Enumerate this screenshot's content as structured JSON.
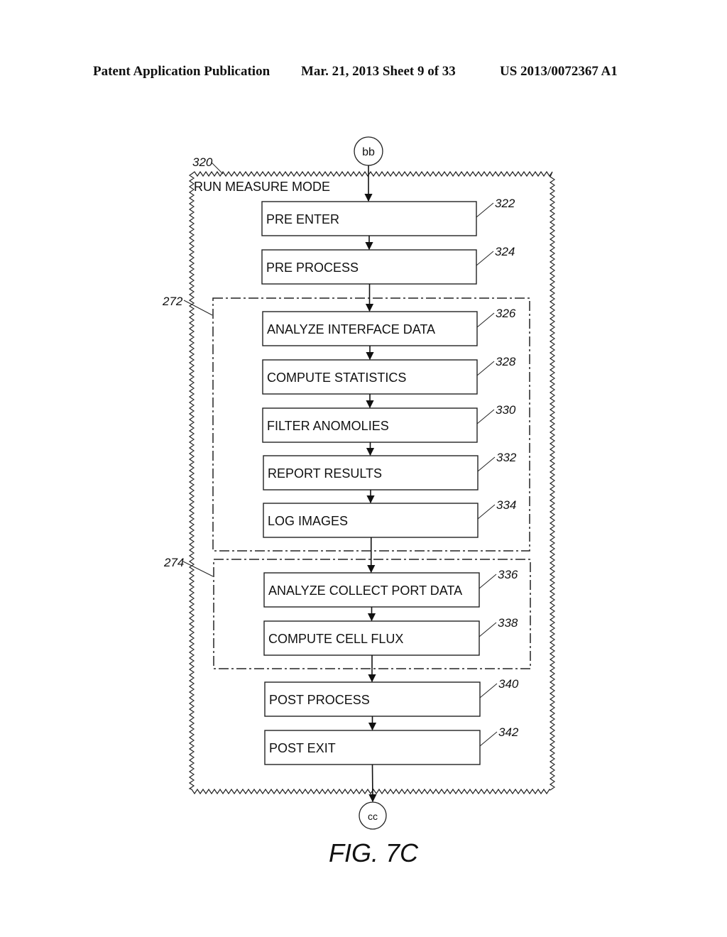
{
  "header": {
    "publication": "Patent Application Publication",
    "date_sheet": "Mar. 21, 2013  Sheet 9 of 33",
    "number": "US 2013/0072367 A1"
  },
  "diagram": {
    "start_connector": "bb",
    "end_connector": "cc",
    "outer": {
      "ref": "320",
      "title": "RUN MEASURE MODE"
    },
    "groups": [
      {
        "ref": "272"
      },
      {
        "ref": "274"
      }
    ],
    "steps": [
      {
        "ref": "322",
        "label": "PRE ENTER"
      },
      {
        "ref": "324",
        "label": "PRE PROCESS"
      },
      {
        "ref": "326",
        "label": "ANALYZE INTERFACE DATA"
      },
      {
        "ref": "328",
        "label": "COMPUTE STATISTICS"
      },
      {
        "ref": "330",
        "label": "FILTER ANOMOLIES"
      },
      {
        "ref": "332",
        "label": "REPORT RESULTS"
      },
      {
        "ref": "334",
        "label": "LOG IMAGES"
      },
      {
        "ref": "336",
        "label": "ANALYZE COLLECT PORT DATA"
      },
      {
        "ref": "338",
        "label": "COMPUTE CELL FLUX"
      },
      {
        "ref": "340",
        "label": "POST PROCESS"
      },
      {
        "ref": "342",
        "label": "POST EXIT"
      }
    ],
    "figure_label": "FIG. 7C"
  }
}
